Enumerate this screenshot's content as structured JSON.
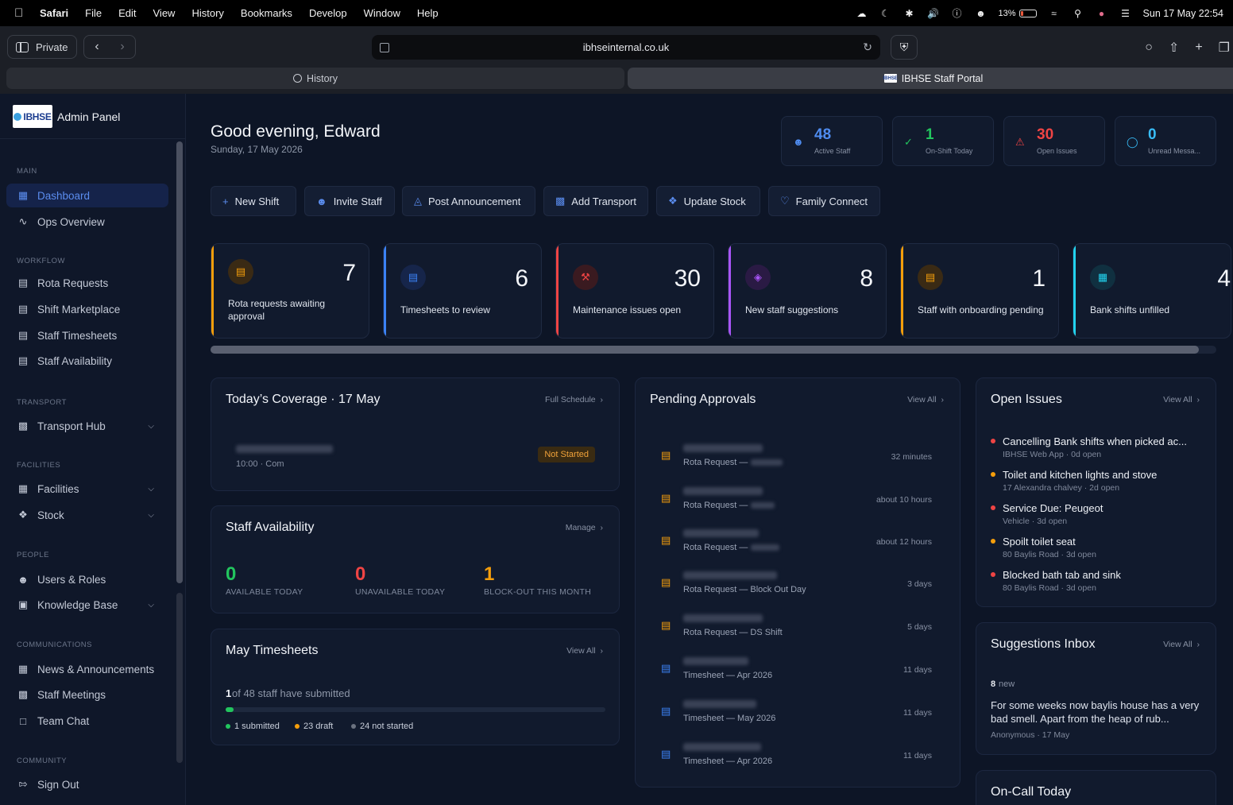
{
  "menubar": {
    "app": "Safari",
    "items": [
      "File",
      "Edit",
      "View",
      "History",
      "Bookmarks",
      "Develop",
      "Window",
      "Help"
    ],
    "battery": "13%",
    "clock": "Sun 17 May  22:54"
  },
  "browser": {
    "private_label": "Private",
    "url": "ibhseinternal.co.uk",
    "tabs": [
      {
        "label": "History",
        "icon": "clock-icon"
      },
      {
        "label": "IBHSE Staff Portal",
        "icon": "favicon"
      }
    ]
  },
  "sidebar": {
    "logo_text": "IBHSE",
    "title": "Admin Panel",
    "sections": {
      "main": "MAIN",
      "workflow": "WORKFLOW",
      "transport": "TRANSPORT",
      "facilities": "FACILITIES",
      "people": "PEOPLE",
      "communications": "COMMUNICATIONS",
      "community": "COMMUNITY"
    },
    "items": {
      "dashboard": "Dashboard",
      "ops": "Ops Overview",
      "rota": "Rota Requests",
      "marketplace": "Shift Marketplace",
      "timesheets": "Staff Timesheets",
      "availability": "Staff Availability",
      "transport": "Transport Hub",
      "facilities": "Facilities",
      "stock": "Stock",
      "users": "Users & Roles",
      "kb": "Knowledge Base",
      "news": "News & Announcements",
      "meetings": "Staff Meetings",
      "chat": "Team Chat",
      "signout": "Sign Out"
    }
  },
  "header": {
    "greeting": "Good evening, Edward",
    "date": "Sunday, 17 May 2026"
  },
  "stats": [
    {
      "value": "48",
      "label": "Active Staff",
      "color": "#4f8cf0",
      "icon": "users-icon"
    },
    {
      "value": "1",
      "label": "On-Shift Today",
      "color": "#22c55e",
      "icon": "check-circle-icon"
    },
    {
      "value": "30",
      "label": "Open Issues",
      "color": "#ef4444",
      "icon": "warning-icon"
    },
    {
      "value": "0",
      "label": "Unread Messa...",
      "color": "#38bdf8",
      "icon": "chat-icon"
    }
  ],
  "quick_actions": [
    "New Shift",
    "Invite Staff",
    "Post Announcement",
    "Add Transport",
    "Update Stock",
    "Family Connect"
  ],
  "kpis": [
    {
      "value": "7",
      "label": "Rota requests awaiting approval",
      "color": "#f59e0b"
    },
    {
      "value": "6",
      "label": "Timesheets to review",
      "color": "#3b82f6"
    },
    {
      "value": "30",
      "label": "Maintenance issues open",
      "color": "#ef4444"
    },
    {
      "value": "8",
      "label": "New staff suggestions",
      "color": "#a855f7"
    },
    {
      "value": "1",
      "label": "Staff with onboarding pending",
      "color": "#f59e0b"
    },
    {
      "value": "4",
      "label": "Bank shifts unfilled",
      "color": "#22d3ee"
    }
  ],
  "coverage": {
    "title": "Today’s Coverage · 17 May",
    "link": "Full Schedule",
    "row_time": "10:00 · Com",
    "status": "Not Started"
  },
  "availability": {
    "title": "Staff Availability",
    "link": "Manage",
    "items": [
      {
        "value": "0",
        "label": "AVAILABLE TODAY",
        "color": "#22c55e"
      },
      {
        "value": "0",
        "label": "UNAVAILABLE TODAY",
        "color": "#ef4444"
      },
      {
        "value": "1",
        "label": "BLOCK-OUT THIS MONTH",
        "color": "#f59e0b"
      }
    ]
  },
  "timesheets": {
    "title": "May Timesheets",
    "link": "View All",
    "count": "1",
    "summary": "of 48 staff have submitted",
    "progress": 0.021,
    "legend": [
      {
        "label": "1 submitted",
        "color": "#22c55e"
      },
      {
        "label": "23 draft",
        "color": "#f59e0b"
      },
      {
        "label": "24 not started",
        "color": "#6b7280"
      }
    ]
  },
  "approvals": {
    "title": "Pending Approvals",
    "link": "View All",
    "rows": [
      {
        "type": "Rota Request —",
        "time": "32 minutes",
        "icon": "calendar-icon"
      },
      {
        "type": "Rota Request —",
        "time": "about 10 hours",
        "icon": "calendar-icon"
      },
      {
        "type": "Rota Request —",
        "time": "about 12 hours",
        "icon": "calendar-icon"
      },
      {
        "type": "Rota Request — Block Out Day",
        "time": "3 days",
        "icon": "calendar-icon"
      },
      {
        "type": "Rota Request — DS Shift",
        "time": "5 days",
        "icon": "calendar-icon"
      },
      {
        "type": "Timesheet — Apr 2026",
        "time": "11 days",
        "icon": "document-icon"
      },
      {
        "type": "Timesheet — May 2026",
        "time": "11 days",
        "icon": "document-icon"
      },
      {
        "type": "Timesheet — Apr 2026",
        "time": "11 days",
        "icon": "document-icon"
      }
    ]
  },
  "issues": {
    "title": "Open Issues",
    "link": "View All",
    "rows": [
      {
        "title": "Cancelling Bank shifts when picked ac...",
        "sub": "IBHSE Web App · 0d open",
        "color": "#ef4444"
      },
      {
        "title": "Toilet and kitchen lights and stove",
        "sub": "17 Alexandra chalvey · 2d open",
        "color": "#f59e0b"
      },
      {
        "title": "Service Due: Peugeot",
        "sub": "Vehicle · 3d open",
        "color": "#ef4444"
      },
      {
        "title": "Spoilt toilet seat",
        "sub": "80 Baylis Road · 3d open",
        "color": "#f59e0b"
      },
      {
        "title": "Blocked bath tab and sink",
        "sub": "80 Baylis Road · 3d open",
        "color": "#ef4444"
      }
    ]
  },
  "suggestions": {
    "title": "Suggestions Inbox",
    "link": "View All",
    "count": "8",
    "count_label": "new",
    "text": "For some weeks now baylis house has a very bad smell. Apart from the heap of rub...",
    "meta": "Anonymous · 17 May"
  },
  "oncall": {
    "title": "On-Call Today"
  }
}
